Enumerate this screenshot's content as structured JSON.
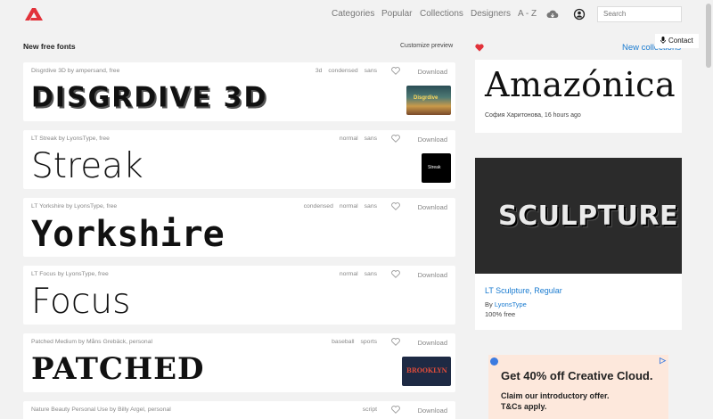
{
  "nav": {
    "links": [
      "Categories",
      "Popular",
      "Collections",
      "Designers",
      "A - Z"
    ],
    "search_placeholder": "Search"
  },
  "main": {
    "title": "New free fonts",
    "customize": "Customize preview",
    "fonts": [
      {
        "meta": "Disgrdive 3D by ampersand, free",
        "tags": [
          "3d",
          "condensed",
          "sans"
        ],
        "preview": "DISGRDIVE 3D",
        "download": "Download",
        "thumb": "Disgrdive"
      },
      {
        "meta": "LT Streak by LyonsType, free",
        "tags": [
          "normal",
          "sans"
        ],
        "preview": "Streak",
        "download": "Download",
        "thumb": "Streak"
      },
      {
        "meta": "LT Yorkshire by LyonsType, free",
        "tags": [
          "condensed",
          "normal",
          "sans"
        ],
        "preview": "Yorkshire",
        "download": "Download",
        "thumb": ""
      },
      {
        "meta": "LT Focus by LyonsType, free",
        "tags": [
          "normal",
          "sans"
        ],
        "preview": "Focus",
        "download": "Download",
        "thumb": ""
      },
      {
        "meta": "Patched Medium by Måns Grebäck, personal",
        "tags": [
          "baseball",
          "sports"
        ],
        "preview": "PATCHED",
        "download": "Download",
        "thumb": "BROOKLYN"
      },
      {
        "meta": "Nature Beauty Personal Use by Billy Argel, personal",
        "tags": [
          "script"
        ],
        "preview": "",
        "download": "Download",
        "thumb": ""
      }
    ]
  },
  "side": {
    "new_collections": "New collections",
    "contact": "Contact",
    "featured": {
      "preview": "Amazónica",
      "meta": "София Харитонова, 16 hours ago"
    },
    "sculpture": {
      "image_text": "SCULPTURE",
      "title": "LT Sculpture, Regular",
      "by_prefix": "By ",
      "by_link": "LyonsType",
      "license": "100% free"
    },
    "ad": {
      "headline": "Get 40% off Creative Cloud.",
      "line1": "Claim our introductory offer.",
      "line2": "T&Cs apply."
    }
  },
  "colors": {
    "accent": "#e2323a",
    "link": "#1a7bd0"
  }
}
